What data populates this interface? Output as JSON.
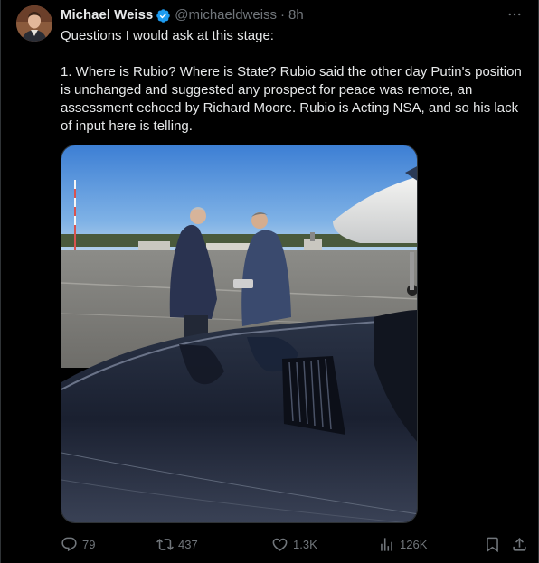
{
  "author": {
    "display_name": "Michael Weiss",
    "handle": "@michaeldweiss",
    "separator": "·",
    "time": "8h",
    "verified": true
  },
  "tweet": {
    "paragraphs": [
      "Questions I would ask at this stage:",
      "1. Where is Rubio? Where is State? Rubio said the other day Putin's position is unchanged and suggested any prospect for peace was remote, an assessment echoed by Richard Moore. Rubio is Acting NSA, and so his lack of input here is telling."
    ]
  },
  "media": {
    "alt": ""
  },
  "actions": {
    "replies": "79",
    "reposts": "437",
    "likes": "1.3K",
    "views": "126K"
  },
  "icons": {
    "verified": "verified-badge-icon",
    "more": "more-horizontal-icon",
    "reply": "reply-icon",
    "repost": "repost-icon",
    "like": "heart-icon",
    "views": "views-icon",
    "bookmark": "bookmark-icon",
    "share": "share-icon"
  },
  "colors": {
    "background": "#000000",
    "text": "#e7e9ea",
    "secondary": "#71767b",
    "verified": "#1d9bf0",
    "border": "#2f3336"
  }
}
